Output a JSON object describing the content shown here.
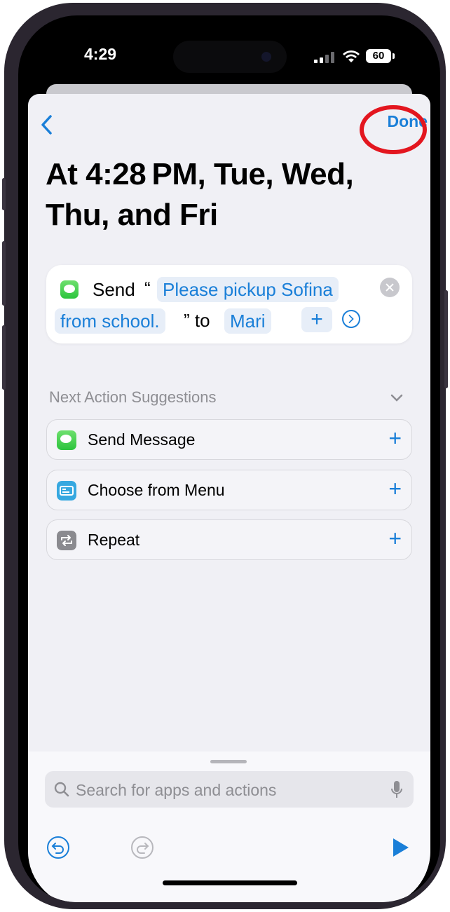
{
  "status_bar": {
    "time": "4:29",
    "battery": "60"
  },
  "nav": {
    "back_icon": "chevron-left-icon",
    "done_label": "Done"
  },
  "title": "At 4:28 PM, Tue, Wed, Thu, and Fri",
  "action": {
    "verb": "Send",
    "open_quote": "“",
    "message_part1": "Please pickup Sofina",
    "message_part2": "from school.",
    "close_quote_to": "” to",
    "recipient": "Mari",
    "add_label": "+"
  },
  "suggestions": {
    "header": "Next Action Suggestions",
    "items": [
      {
        "label": "Send Message",
        "icon": "messages-icon"
      },
      {
        "label": "Choose from Menu",
        "icon": "menu-icon"
      },
      {
        "label": "Repeat",
        "icon": "repeat-icon"
      }
    ],
    "add_label": "+"
  },
  "search": {
    "placeholder": "Search for apps and actions"
  },
  "colors": {
    "accent": "#1a7fd8",
    "annotation": "#e3161f",
    "messages_green": "#34c759"
  }
}
